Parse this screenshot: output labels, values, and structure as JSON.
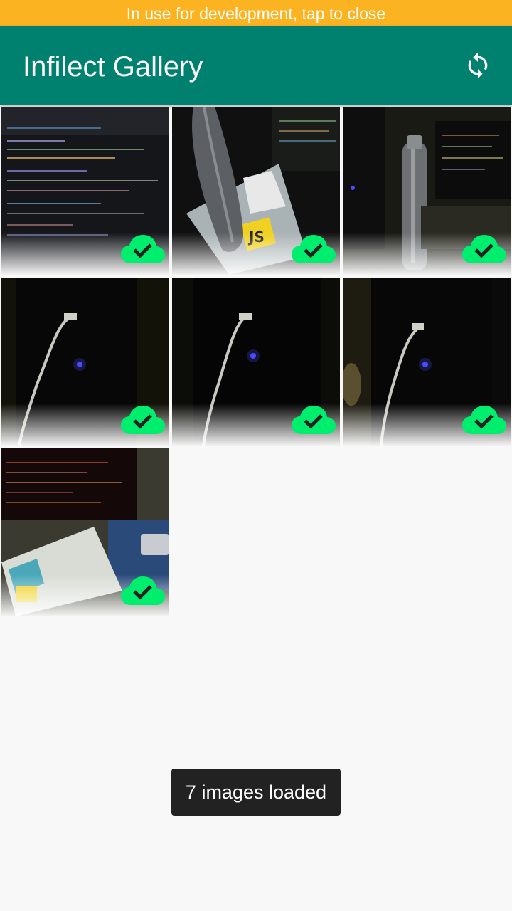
{
  "banner": {
    "text": "In use for development, tap to close"
  },
  "app_bar": {
    "title": "Infilect Gallery",
    "refresh_icon": "sync-icon"
  },
  "gallery": {
    "status_icon": "cloud-check-icon",
    "status_color": "#00ee6e",
    "images": [
      {
        "subject": "code-screen",
        "upload_status": "uploaded"
      },
      {
        "subject": "bottle-and-book",
        "upload_status": "uploaded"
      },
      {
        "subject": "bottle-and-monitor",
        "upload_status": "uploaded"
      },
      {
        "subject": "dark-cpu-with-cable",
        "upload_status": "uploaded"
      },
      {
        "subject": "dark-cpu-with-cable",
        "upload_status": "uploaded"
      },
      {
        "subject": "dark-cpu-with-cable",
        "upload_status": "uploaded"
      },
      {
        "subject": "monitor-and-books",
        "upload_status": "uploaded"
      }
    ]
  },
  "toast": {
    "text": "7 images loaded"
  },
  "colors": {
    "banner": "#fcb322",
    "app_bar": "#00806f",
    "background": "#f8f8f8",
    "toast": "#222222"
  }
}
